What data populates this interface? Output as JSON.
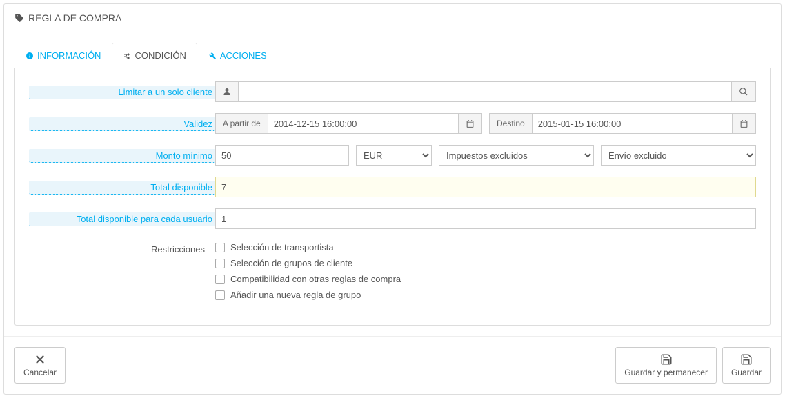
{
  "panel": {
    "title": "REGLA DE COMPRA"
  },
  "tabs": {
    "info": "INFORMACIÓN",
    "condition": "CONDICIÓN",
    "actions": "ACCIONES"
  },
  "form": {
    "limit_customer_label": "Limitar a un solo cliente",
    "limit_customer_value": "",
    "validity_label": "Validez",
    "validity_from_label": "A partir de",
    "validity_from_value": "2014-12-15 16:00:00",
    "validity_to_label": "Destino",
    "validity_to_value": "2015-01-15 16:00:00",
    "min_amount_label": "Monto mínimo",
    "min_amount_value": "50",
    "currency_selected": "EUR",
    "tax_selected": "Impuestos excluidos",
    "shipping_selected": "Envío excluido",
    "total_available_label": "Total disponible",
    "total_available_value": "7",
    "per_user_label": "Total disponible para cada usuario",
    "per_user_value": "1",
    "restrictions_label": "Restricciones",
    "restrictions": {
      "carrier": "Selección de transportista",
      "groups": "Selección de grupos de cliente",
      "compat": "Compatibilidad con otras reglas de compra",
      "add_group": "Añadir una nueva regla de grupo"
    }
  },
  "footer": {
    "cancel": "Cancelar",
    "save_stay": "Guardar y permanecer",
    "save": "Guardar"
  }
}
